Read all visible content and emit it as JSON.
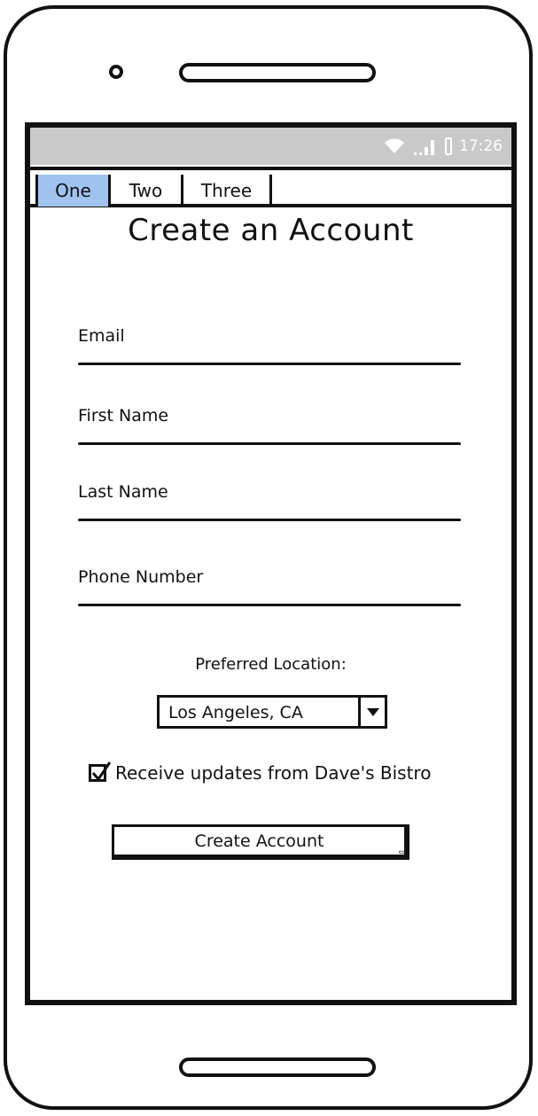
{
  "status_bar": {
    "time": "17:26"
  },
  "tabs": [
    {
      "label": "One",
      "active": true
    },
    {
      "label": "Two",
      "active": false
    },
    {
      "label": "Three",
      "active": false
    }
  ],
  "page_title": "Create an Account",
  "fields": {
    "email": {
      "label": "Email"
    },
    "first_name": {
      "label": "First Name"
    },
    "last_name": {
      "label": "Last Name"
    },
    "phone": {
      "label": "Phone Number"
    }
  },
  "location": {
    "label": "Preferred Location:",
    "selected": "Los Angeles, CA"
  },
  "updates_checkbox": {
    "label": "Receive updates from Dave's Bistro",
    "checked": true
  },
  "submit_label": "Create Account",
  "colors": {
    "active_tab": "#9fc3ee",
    "status_bar": "#c9c9c9"
  }
}
